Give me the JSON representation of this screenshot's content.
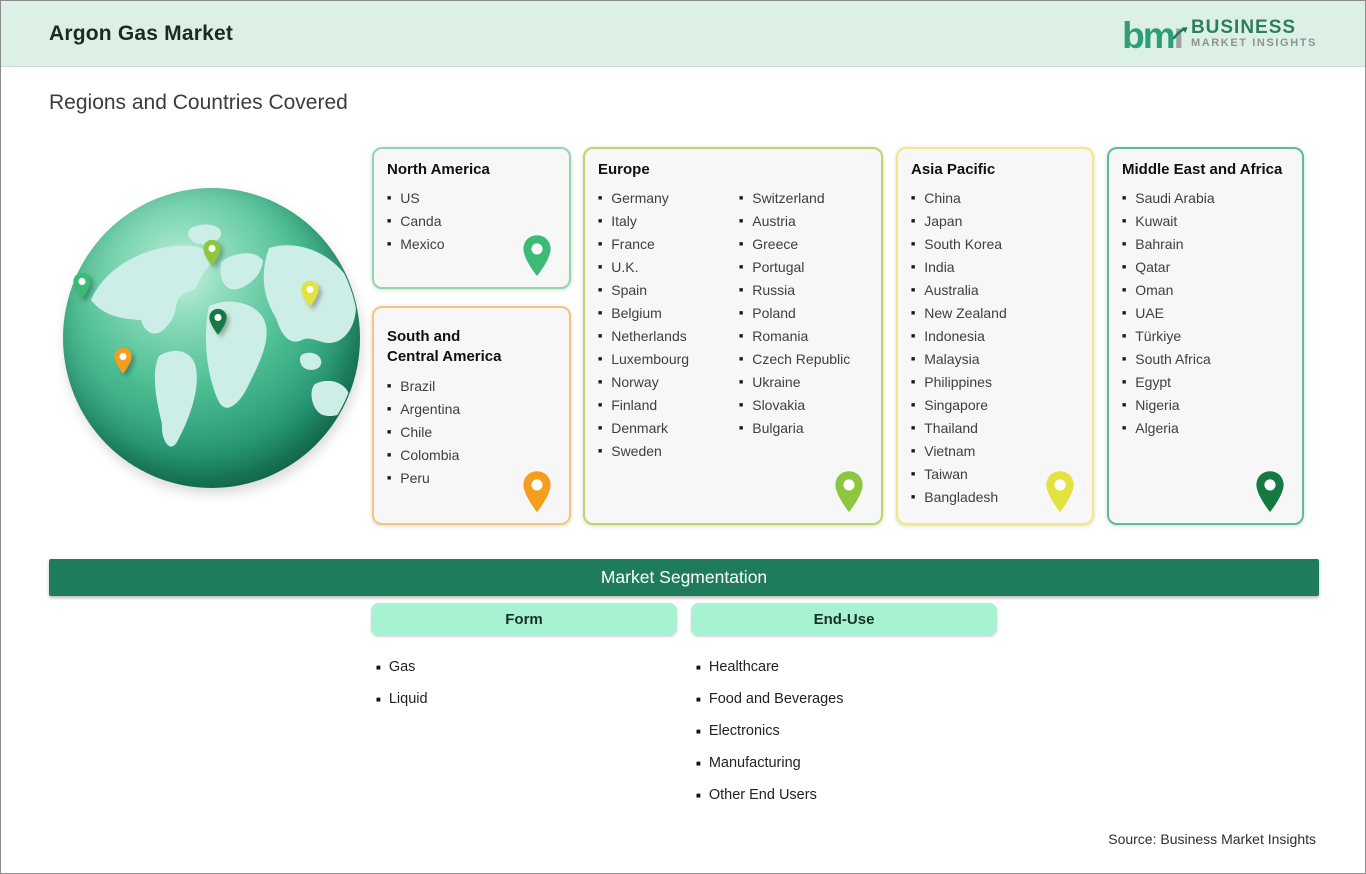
{
  "header": {
    "title": "Argon Gas Market",
    "logo": {
      "mark_bm": "bm",
      "mark_i": "ı",
      "line1": "BUSINESS",
      "line2": "MARKET INSIGHTS"
    }
  },
  "section_title": "Regions and Countries Covered",
  "regions": [
    {
      "id": "north-america",
      "name": "North America",
      "countries": [
        "US",
        "Canda",
        "Mexico"
      ],
      "border_color": "#8fd6ae",
      "pin_color": "#3dba76"
    },
    {
      "id": "south-central-america",
      "name": "South and Central America",
      "countries": [
        "Brazil",
        "Argentina",
        "Chile",
        "Colombia",
        "Peru"
      ],
      "border_color": "#f5c579",
      "pin_color": "#f59d1e"
    },
    {
      "id": "europe",
      "name": "Europe",
      "countries": [
        "Germany",
        "Italy",
        "France",
        "U.K.",
        "Spain",
        "Belgium",
        "Netherlands",
        "Luxembourg",
        "Norway",
        "Finland",
        "Denmark",
        "Sweden",
        "Switzerland",
        "Austria",
        "Greece",
        "Portugal",
        "Russia",
        "Poland",
        "Romania",
        "Czech Republic",
        "Ukraine",
        "Slovakia",
        "Bulgaria"
      ],
      "border_color": "#b8d96a",
      "pin_color": "#8dc63f"
    },
    {
      "id": "asia-pacific",
      "name": "Asia Pacific",
      "countries": [
        "China",
        "Japan",
        "South Korea",
        "India",
        "Australia",
        "New Zealand",
        "Indonesia",
        "Malaysia",
        "Philippines",
        "Singapore",
        "Thailand",
        "Vietnam",
        "Taiwan",
        "Bangladesh"
      ],
      "border_color": "#efe97e",
      "pin_color": "#e3e23e"
    },
    {
      "id": "middle-east-africa",
      "name": "Middle East and Africa",
      "countries": [
        "Saudi Arabia",
        "Kuwait",
        "Bahrain",
        "Qatar",
        "Oman",
        "UAE",
        "Türkiye",
        "South Africa",
        "Egypt",
        "Nigeria",
        "Algeria"
      ],
      "border_color": "#5ebd97",
      "pin_color": "#157a42"
    }
  ],
  "segmentation": {
    "title": "Market Segmentation",
    "columns": [
      {
        "header": "Form",
        "items": [
          "Gas",
          "Liquid"
        ]
      },
      {
        "header": "End-Use",
        "items": [
          "Healthcare",
          "Food and Beverages",
          "Electronics",
          "Manufacturing",
          "Other End Users"
        ]
      }
    ]
  },
  "source": "Source: Business Market Insights",
  "colors": {
    "header_band": "#ddf0e6",
    "segmentation_bar": "#1e7c5b",
    "segment_pill": "#a7f2d0",
    "globe_sea": "#249470",
    "globe_land": "#cdeee7",
    "logo_green": "#2f9e78",
    "logo_gray": "#8d9396"
  }
}
